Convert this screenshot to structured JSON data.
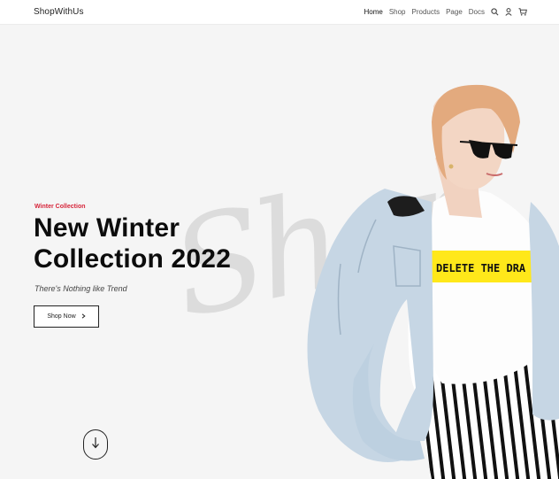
{
  "header": {
    "brand": "ShopWithUs",
    "nav": [
      "Home",
      "Shop",
      "Products",
      "Page",
      "Docs"
    ],
    "icons": [
      "search-icon",
      "user-icon",
      "cart-icon"
    ]
  },
  "hero": {
    "eyebrow": "Winter Collection",
    "title_line1": "New Winter",
    "title_line2": "Collection 2022",
    "subtitle": "There's Nothing like Trend",
    "cta_label": "Shop Now",
    "watermark": "Shop",
    "tshirt_text": "DELETE THE DRA"
  },
  "colors": {
    "accent": "#d6253a",
    "background": "#f5f5f5",
    "text": "#0c0c0c"
  }
}
